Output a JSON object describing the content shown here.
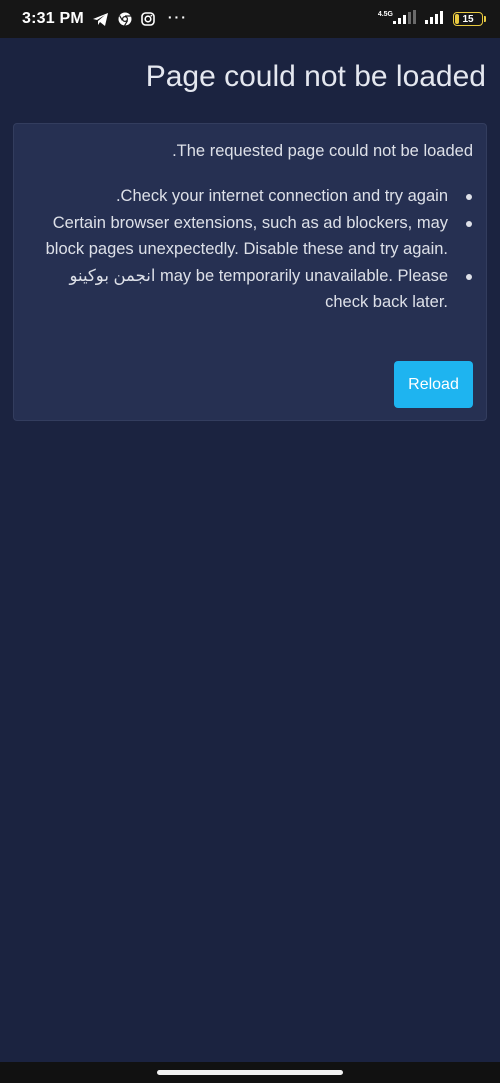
{
  "status_bar": {
    "time": "3:31 PM",
    "left_icons": [
      "telegram-icon",
      "chrome-icon",
      "instagram-icon"
    ],
    "more_indicator": "···",
    "network_type": "4.5G",
    "battery_level_text": "15",
    "battery_level": 0.15,
    "colors": {
      "background": "#161616",
      "battery": "#e8c940"
    }
  },
  "page": {
    "title": "Page could not be loaded",
    "message": ".The requested page could not be loaded",
    "tips": [
      {
        "text": ".Check your internet connection and try again"
      },
      {
        "text": "Certain browser extensions, such as ad blockers, may block pages unexpectedly. Disable these and try again."
      },
      {
        "text": "انجمن بوکینو may be temporarily unavailable. Please check back later."
      }
    ],
    "reload_label": "Reload",
    "colors": {
      "background": "#1b2340",
      "card": "#263052",
      "accent": "#1eb4f0"
    }
  }
}
